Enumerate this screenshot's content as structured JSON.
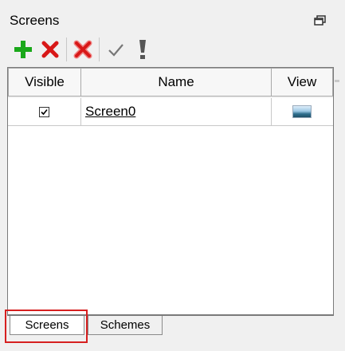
{
  "panel": {
    "title": "Screens",
    "restore_icon": "restore-window-icon"
  },
  "toolbar": {
    "buttons": [
      {
        "icon": "add-icon",
        "color": "#1aa81a"
      },
      {
        "icon": "delete-icon",
        "color": "#d81818"
      },
      {
        "icon": "delete-all-icon",
        "color": "#d81818"
      },
      {
        "icon": "check-icon",
        "color": "#777777"
      },
      {
        "icon": "exclamation-icon",
        "color": "#555555"
      }
    ]
  },
  "grid": {
    "columns": [
      "Visible",
      "Name",
      "View"
    ],
    "rows": [
      {
        "visible": true,
        "name": "Screen0",
        "view_icon": "landscape-thumbnail-icon"
      }
    ]
  },
  "tabs": [
    {
      "label": "Screens",
      "active": true
    },
    {
      "label": "Schemes",
      "active": false
    }
  ],
  "highlight_color": "#d62020"
}
